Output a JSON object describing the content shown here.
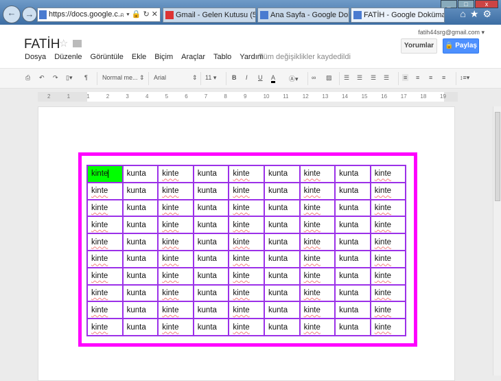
{
  "browser": {
    "address": "https://docs.google.c...",
    "tabs": [
      {
        "label": "Gmail - Gelen Kutusu (5) - f...",
        "icon": "gmail-icon"
      },
      {
        "label": "Ana Sayfa - Google Doküm...",
        "icon": "docs-home-icon"
      },
      {
        "label": "FATİH - Google Dokümа...",
        "icon": "docs-icon",
        "active": true
      }
    ]
  },
  "doc": {
    "title": "FATİH",
    "account": "fatih44srg@gmail.com",
    "menu": [
      "Dosya",
      "Düzenle",
      "Görüntüle",
      "Ekle",
      "Biçim",
      "Araçlar",
      "Tablo",
      "Yardım"
    ],
    "save_status": "Tüm değişiklikler kaydedildi",
    "comments_label": "Yorumlar",
    "share_label": "Paylaş",
    "share_color": "#4d90fe"
  },
  "toolbar": {
    "style": "Normal me...",
    "font": "Arial",
    "size": "11"
  },
  "ruler": [
    "2",
    "1",
    "1",
    "2",
    "3",
    "4",
    "5",
    "6",
    "7",
    "8",
    "9",
    "10",
    "11",
    "12",
    "13",
    "14",
    "15",
    "16",
    "17",
    "18",
    "19"
  ],
  "table": {
    "outer_border_color": "#ff00ff",
    "inner_border_color": "#9b30e8",
    "selected_cell_color": "#00ff00",
    "rows": 10,
    "columns": [
      "kinte",
      "kunta",
      "kinte",
      "kunta",
      "kinte",
      "kunta",
      "kinte",
      "kunta",
      "kinte"
    ]
  }
}
